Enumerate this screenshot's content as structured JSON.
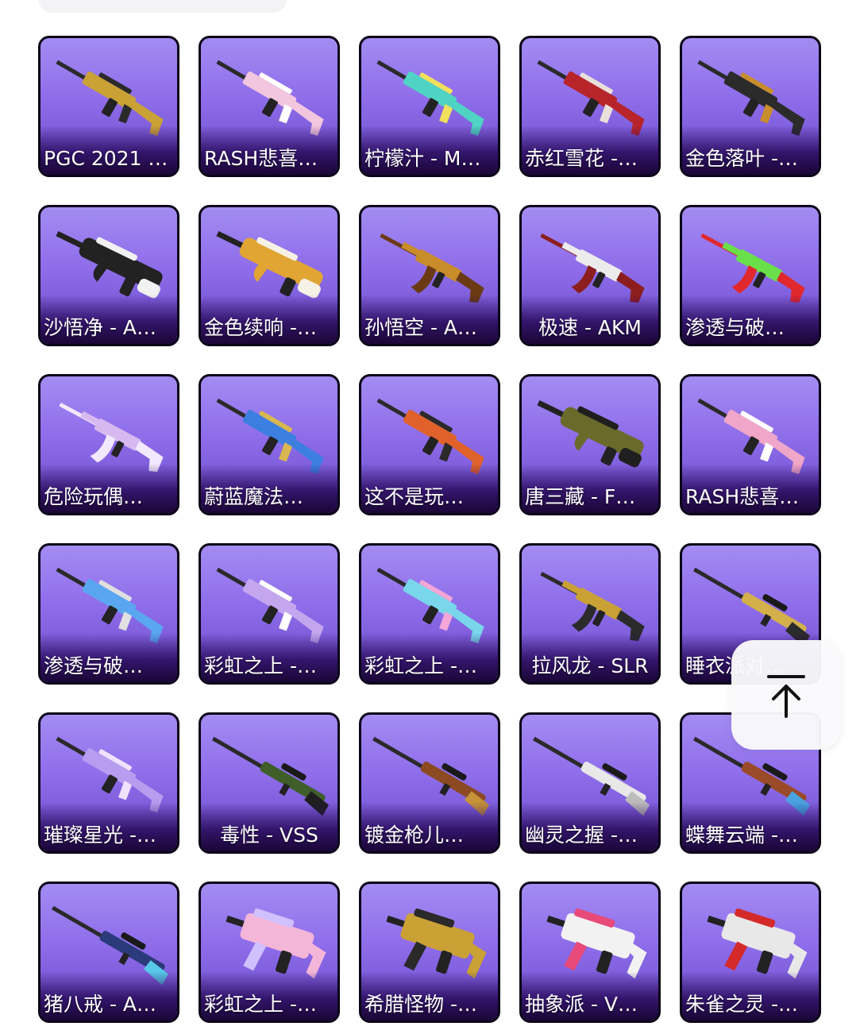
{
  "skins": [
    {
      "label": "PGC 2021 …",
      "gun": "rifle",
      "colors": [
        "#c9a135",
        "#2a2a2a"
      ]
    },
    {
      "label": "RASH悲喜…",
      "gun": "rifle",
      "colors": [
        "#f2c6de",
        "#ffffff"
      ]
    },
    {
      "label": "柠檬汁 - M…",
      "gun": "rifle",
      "colors": [
        "#4fd4c3",
        "#f1e05b"
      ]
    },
    {
      "label": "赤红雪花 -…",
      "gun": "rifle",
      "colors": [
        "#b7252b",
        "#e9e0da"
      ]
    },
    {
      "label": "金色落叶 -…",
      "gun": "rifle",
      "colors": [
        "#2b2b2b",
        "#c88d2c"
      ]
    },
    {
      "label": "沙悟净 - A…",
      "gun": "bullpup",
      "colors": [
        "#222222",
        "#f1f1f1"
      ]
    },
    {
      "label": "金色续响 -…",
      "gun": "bullpup",
      "colors": [
        "#e0a533",
        "#f6f2e6"
      ]
    },
    {
      "label": "孙悟空 - A…",
      "gun": "ak",
      "colors": [
        "#c98c2b",
        "#6b3a14"
      ]
    },
    {
      "label": "极速 - AKM",
      "gun": "ak",
      "colors": [
        "#ececec",
        "#8c1e1e"
      ]
    },
    {
      "label": "渗透与破…",
      "gun": "ak",
      "colors": [
        "#69e04a",
        "#e0282d"
      ]
    },
    {
      "label": "危险玩偶…",
      "gun": "ak",
      "colors": [
        "#d7b9f0",
        "#f3e9ff"
      ]
    },
    {
      "label": "蔚蓝魔法…",
      "gun": "rifle",
      "colors": [
        "#3d7fe0",
        "#d8b750"
      ]
    },
    {
      "label": "这不是玩…",
      "gun": "rifle",
      "colors": [
        "#e0622a",
        "#2a2a2a"
      ]
    },
    {
      "label": "唐三藏 - F…",
      "gun": "bullpup",
      "colors": [
        "#6a6a2a",
        "#1f1f1f"
      ]
    },
    {
      "label": "RASH悲喜…",
      "gun": "rifle",
      "colors": [
        "#f0a6c8",
        "#ffffff"
      ]
    },
    {
      "label": "渗透与破…",
      "gun": "rifle",
      "colors": [
        "#5aa6f0",
        "#e0e0e0"
      ]
    },
    {
      "label": "彩虹之上 -…",
      "gun": "rifle",
      "colors": [
        "#c3a6ee",
        "#ffffff"
      ]
    },
    {
      "label": "彩虹之上 -…",
      "gun": "rifle",
      "colors": [
        "#7ad6ea",
        "#f3a6d8"
      ]
    },
    {
      "label": "拉风龙 - SLR",
      "gun": "ak",
      "colors": [
        "#c9a135",
        "#2b2b2b"
      ]
    },
    {
      "label": "睡衣派对…",
      "gun": "sniper",
      "colors": [
        "#d3b04a",
        "#2b2b2b"
      ]
    },
    {
      "label": "璀璨星光 -…",
      "gun": "rifle",
      "colors": [
        "#b69df0",
        "#f0e2ff"
      ]
    },
    {
      "label": "毒性 - VSS",
      "gun": "sniper",
      "colors": [
        "#3f5e2a",
        "#1f1f1f"
      ]
    },
    {
      "label": "镀金枪儿…",
      "gun": "sniper",
      "colors": [
        "#8b4a22",
        "#c5923a"
      ]
    },
    {
      "label": "幽灵之握 -…",
      "gun": "sniper",
      "colors": [
        "#e8e8e8",
        "#bcbcbc"
      ]
    },
    {
      "label": "蝶舞云端 -…",
      "gun": "sniper",
      "colors": [
        "#9a4a28",
        "#4aa3e0"
      ]
    },
    {
      "label": "猪八戒 - A…",
      "gun": "sniper",
      "colors": [
        "#2a3a7a",
        "#58c8e8"
      ]
    },
    {
      "label": "彩虹之上 -…",
      "gun": "smg",
      "colors": [
        "#f3b6d8",
        "#d0c0ff"
      ]
    },
    {
      "label": "希腊怪物 -…",
      "gun": "smg",
      "colors": [
        "#c9a135",
        "#2a2a2a"
      ]
    },
    {
      "label": "抽象派 - V…",
      "gun": "smg",
      "colors": [
        "#f2f2f2",
        "#e84a7a"
      ]
    },
    {
      "label": "朱雀之灵 -…",
      "gun": "smg",
      "colors": [
        "#e8e8e8",
        "#d42a2a"
      ]
    }
  ],
  "back_to_top": {
    "icon": "arrow-up-to-line-icon"
  }
}
